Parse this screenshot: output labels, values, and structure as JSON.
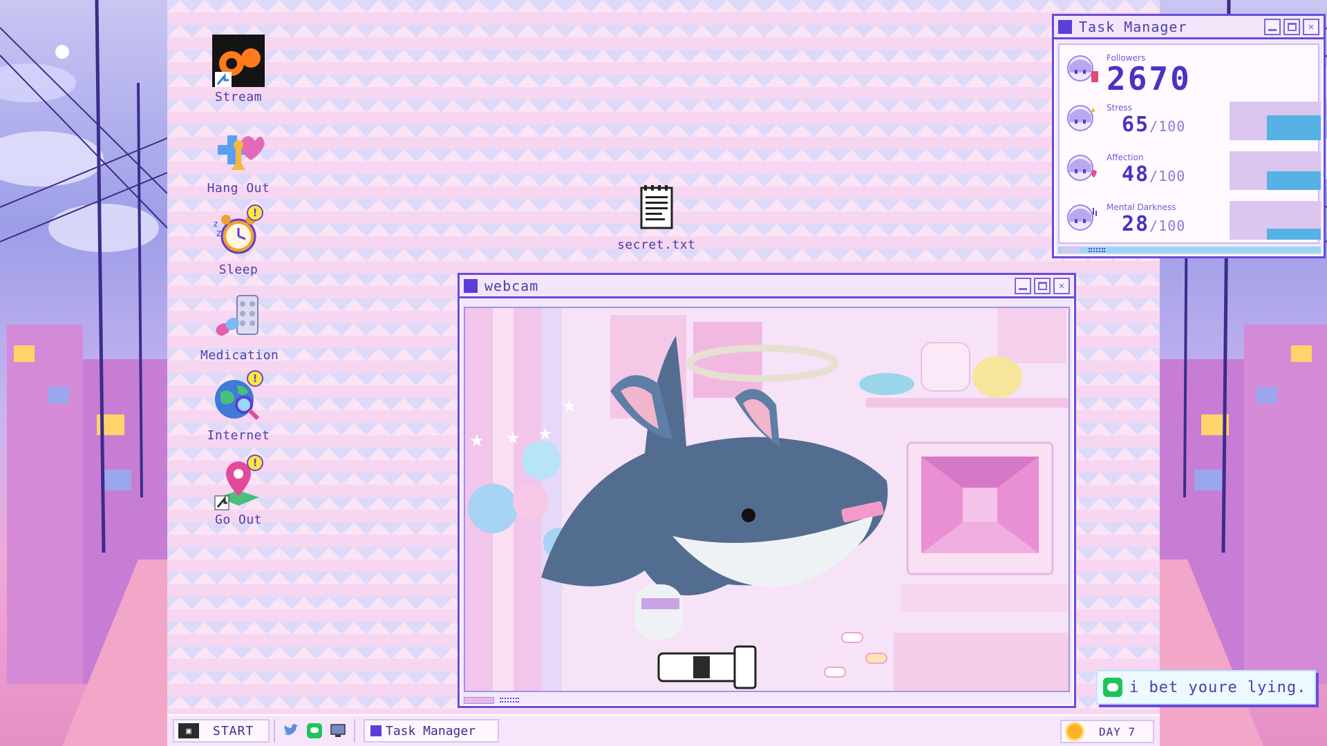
{
  "desktop_icons": [
    {
      "label": "Stream",
      "icon": "stream-app-icon",
      "badge": false
    },
    {
      "label": "Hang Out",
      "icon": "hang-out-icon",
      "badge": false
    },
    {
      "label": "Sleep",
      "icon": "alarm-clock-icon",
      "badge": true
    },
    {
      "label": "Medication",
      "icon": "pill-icon",
      "badge": false
    },
    {
      "label": "Internet",
      "icon": "globe-search-icon",
      "badge": true
    },
    {
      "label": "Go Out",
      "icon": "map-pin-icon",
      "badge": true
    },
    {
      "label": "secret.txt",
      "icon": "notepad-icon",
      "badge": false
    }
  ],
  "badge_symbol": "!",
  "task_manager": {
    "title": "Task Manager",
    "followers": {
      "label": "Followers",
      "value": "2670"
    },
    "stats": [
      {
        "label": "Stress",
        "value": "65",
        "max": "/100",
        "level": 0.65
      },
      {
        "label": "Affection",
        "value": "48",
        "max": "/100",
        "level": 0.48
      },
      {
        "label": "Mental Darkness",
        "value": "28",
        "max": "/100",
        "level": 0.28
      }
    ]
  },
  "webcam": {
    "title": "webcam"
  },
  "chat": {
    "message": "i bet youre lying."
  },
  "taskbar": {
    "start_label": "START",
    "task_label": "Task Manager",
    "day_label": "DAY 7"
  },
  "colors": {
    "accent": "#6a4bd6",
    "bar_fill": "#56b1e4",
    "bar_bg": "#dcc6ef",
    "chat_icon": "#1ec45a"
  }
}
